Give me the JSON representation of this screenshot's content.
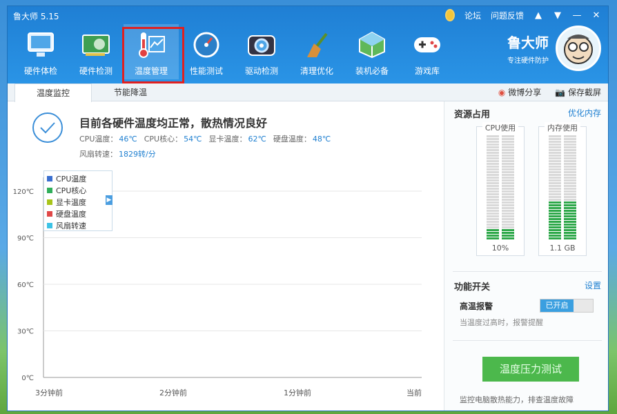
{
  "app": {
    "title": "鲁大师 5.15"
  },
  "topbar": {
    "forum": "论坛",
    "feedback": "问题反馈"
  },
  "brand": {
    "name": "鲁大师",
    "slogan": "专注硬件防护"
  },
  "nav": [
    {
      "label": "硬件体检",
      "icon": "monitor-icon"
    },
    {
      "label": "硬件检测",
      "icon": "hardware-card-icon"
    },
    {
      "label": "温度管理",
      "icon": "thermometer-icon",
      "active": true
    },
    {
      "label": "性能测试",
      "icon": "speedometer-icon"
    },
    {
      "label": "驱动检测",
      "icon": "driver-gear-icon"
    },
    {
      "label": "清理优化",
      "icon": "broom-icon"
    },
    {
      "label": "装机必备",
      "icon": "package-cube-icon"
    },
    {
      "label": "游戏库",
      "icon": "gamepad-icon"
    }
  ],
  "subtabs": [
    {
      "label": "温度监控",
      "active": true
    },
    {
      "label": "节能降温"
    }
  ],
  "share": {
    "weibo": "微博分享",
    "screenshot": "保存截屏"
  },
  "status": {
    "title": "目前各硬件温度均正常，散热情况良好",
    "metrics": [
      {
        "label": "CPU温度：",
        "value": "46℃"
      },
      {
        "label": "CPU核心：",
        "value": "54℃"
      },
      {
        "label": "显卡温度：",
        "value": "62℃"
      },
      {
        "label": "硬盘温度：",
        "value": "48℃"
      }
    ],
    "fan": {
      "label": "风扇转速：",
      "value": "1829转/分"
    }
  },
  "chart_data": {
    "type": "line",
    "y_ticks": [
      "120℃",
      "90℃",
      "60℃",
      "30℃",
      "0℃"
    ],
    "ylim": [
      0,
      120
    ],
    "x_ticks": [
      "3分钟前",
      "2分钟前",
      "1分钟前",
      "当前"
    ],
    "legend": [
      {
        "name": "CPU温度",
        "color": "#3a6fd0"
      },
      {
        "name": "CPU核心",
        "color": "#2fae5a"
      },
      {
        "name": "显卡温度",
        "color": "#a8c41a"
      },
      {
        "name": "硬盘温度",
        "color": "#e04848"
      },
      {
        "name": "风扇转速",
        "color": "#3cc3e6"
      }
    ],
    "series": []
  },
  "side": {
    "resource_title": "资源占用",
    "optimize_link": "优化内存",
    "cpu": {
      "label": "CPU使用",
      "value": "10%",
      "fill": 0.1
    },
    "mem": {
      "label": "内存使用",
      "value": "1.1 GB",
      "fill": 0.37
    },
    "feature_title": "功能开关",
    "settings_link": "设置",
    "alarm_label": "高温报警",
    "alarm_state": "已开启",
    "alarm_desc": "当温度过高时，报警提醒",
    "test_button": "温度压力测试",
    "test_desc": "监控电脑散热能力，排查温度故障"
  }
}
